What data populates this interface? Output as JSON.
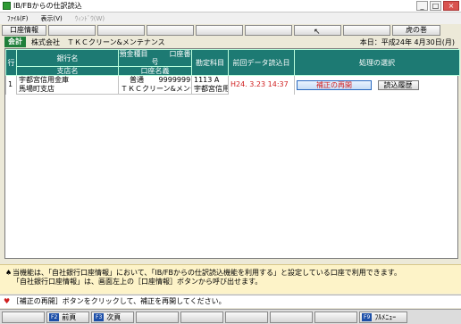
{
  "window": {
    "title": "IB/FBからの仕訳読込",
    "minimize": "_",
    "maximize": "□",
    "close": "×"
  },
  "menu": {
    "file": "ﾌｧｲﾙ(F)",
    "view": "表示(V)",
    "window": "ｳｨﾝﾄﾞｳ(W)"
  },
  "toolbar": {
    "account_info": "口座情報",
    "tora_no_maki": "虎の巻"
  },
  "header": {
    "badge": "会計",
    "company": "株式会社　ＴＫＣクリーン&メンテナンス",
    "today": "本日：平成24年 4月30日(月)"
  },
  "table": {
    "headers": {
      "row": "行",
      "bank": "銀行名",
      "branch": "支店名",
      "deposit_type": "預金種目",
      "account_number": "口座番号",
      "account_name": "口座名義",
      "subject": "勘定科目",
      "last_read": "前回データ読込日",
      "action": "処理の選択"
    },
    "rows": [
      {
        "row": "1",
        "bank": "宇都宮信用金庫",
        "branch": "馬場町支店",
        "deposit_type": "普通",
        "account_number": "9999999",
        "account_name": "ＴＫＣクリーン&メンテナンス",
        "subject_code": "1113 A",
        "subject_name": "宇都宮信用",
        "last_read": "H24. 3.23 14:37",
        "resume_button": "補正の再開",
        "history_button": "読込履歴"
      }
    ]
  },
  "notice": {
    "line1": "当機能は、「自社銀行口座情報」において、「IB/FBからの仕訳読込機能を利用する」と設定している口座で利用できます。",
    "line2": "「自社銀行口座情報」は、画面左上の［口座情報］ボタンから呼び出せます。"
  },
  "status": {
    "text": "［補正の再開］ボタンをクリックして、補正を再開してください。"
  },
  "fkeys": [
    {
      "key": "F2",
      "label": "前頁"
    },
    {
      "key": "F3",
      "label": "次頁"
    },
    {
      "key": "F9",
      "label": "ﾌﾙﾒﾆｭｰ"
    }
  ],
  "colors": {
    "table_header": "#1d7a73",
    "badge_green": "#1f7f3a",
    "notice_bg": "#fdf3c8",
    "alert_red": "#d02020"
  }
}
